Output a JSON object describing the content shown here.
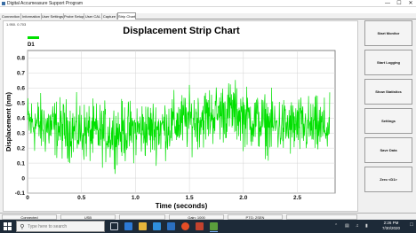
{
  "window": {
    "title": "Digital Accumeasure Support Program",
    "minimize": "—",
    "maximize": "☐",
    "close": "✕"
  },
  "menu": [
    "File",
    "Tools",
    "Factory",
    "Help"
  ],
  "tabs": [
    {
      "label": "Connection",
      "active": false
    },
    {
      "label": "Information",
      "active": false
    },
    {
      "label": "User Settings",
      "active": false
    },
    {
      "label": "Probe Setup",
      "active": false
    },
    {
      "label": "User CAL",
      "active": false
    },
    {
      "label": "Capture",
      "active": false
    },
    {
      "label": "Strip Chart",
      "active": true
    }
  ],
  "version": "1.950. 0.703",
  "chart_data": {
    "type": "line",
    "title": "Displacement Strip Chart",
    "xlabel": "Time (seconds)",
    "ylabel": "Displacement (nm)",
    "xlim": [
      0,
      2.85
    ],
    "ylim": [
      -0.1,
      0.85
    ],
    "xticks": [
      "0",
      "0.5",
      "1.0",
      "1.5",
      "2.0",
      "2.5"
    ],
    "yticks": [
      "-0.1",
      "0",
      "0.1",
      "0.2",
      "0.3",
      "0.4",
      "0.5",
      "0.6",
      "0.7",
      "0.8"
    ],
    "grid": true,
    "legend": "top-left",
    "series": [
      {
        "name": "D1",
        "color": "#00e000",
        "x_start": 0,
        "x_end": 2.8,
        "trend": [
          [
            0.0,
            0.37
          ],
          [
            0.2,
            0.34
          ],
          [
            0.4,
            0.32
          ],
          [
            0.6,
            0.3
          ],
          [
            0.8,
            0.3
          ],
          [
            1.0,
            0.32
          ],
          [
            1.2,
            0.33
          ],
          [
            1.4,
            0.37
          ],
          [
            1.6,
            0.4
          ],
          [
            1.8,
            0.44
          ],
          [
            1.9,
            0.45
          ],
          [
            2.0,
            0.41
          ],
          [
            2.2,
            0.36
          ],
          [
            2.4,
            0.34
          ],
          [
            2.6,
            0.34
          ],
          [
            2.8,
            0.33
          ]
        ],
        "spread": 0.18,
        "min": -0.06,
        "max": 0.82
      }
    ]
  },
  "buttons": {
    "start_monitor": "Start Monitor",
    "start_logging": "Start Logging",
    "show_statistics": "Show Statistics",
    "settings": "Settings",
    "save_data": "Save Data",
    "zero_d1": "Zero <D1>"
  },
  "status": {
    "connected": "Connected",
    "usb": "USB",
    "gain": "Gain: 1000",
    "ptg": "PTG: 2SEN",
    "blank1": "",
    "blank2": ""
  },
  "taskbar": {
    "search_placeholder": "Type here to search",
    "time": "2:26 PM",
    "date": "7/30/2020"
  }
}
